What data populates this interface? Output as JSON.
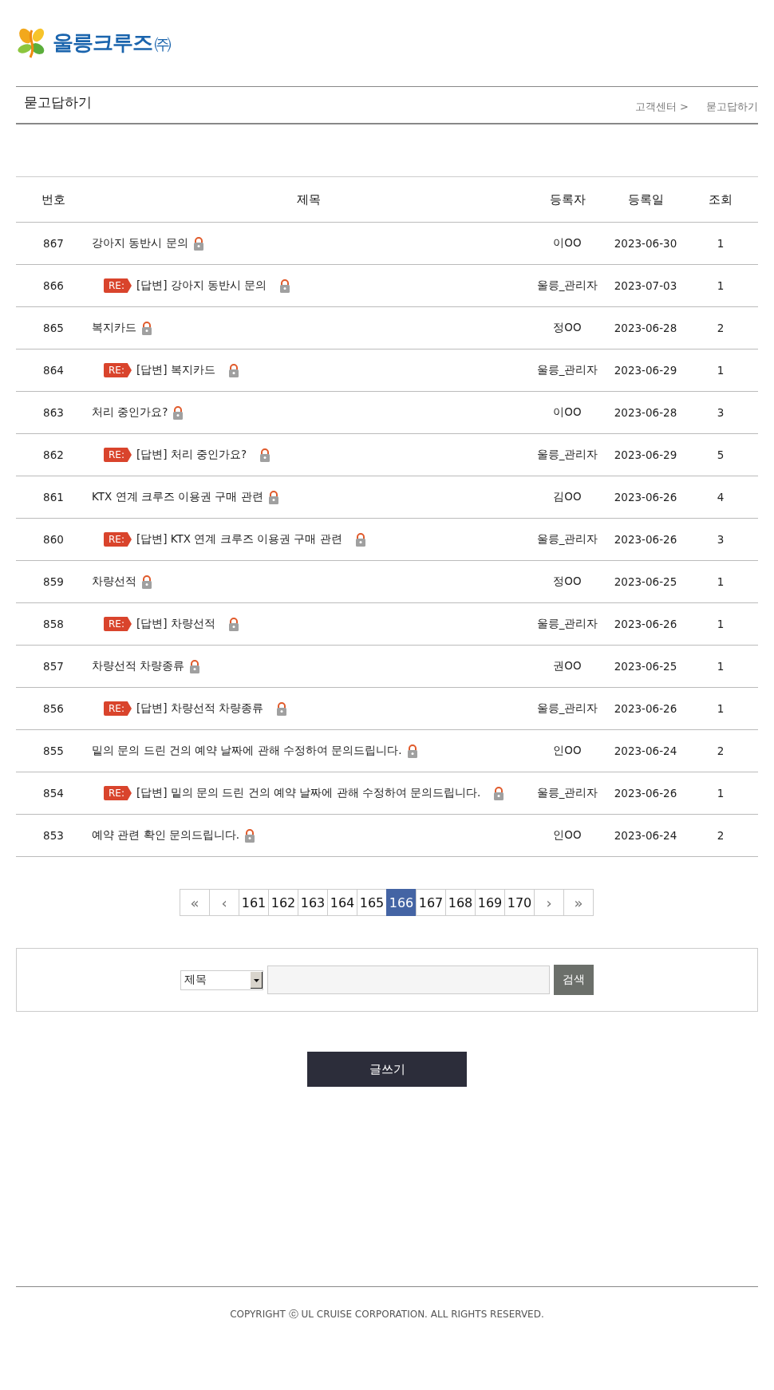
{
  "logo": {
    "name": "울릉크루즈",
    "suffix": "㈜"
  },
  "page_title": "묻고답하기",
  "breadcrumb": [
    "고객센터 >",
    "묻고답하기"
  ],
  "table": {
    "columns": [
      "번호",
      "제목",
      "등록자",
      "등록일",
      "조회"
    ],
    "rows": [
      {
        "number": "867",
        "kind": "question",
        "title": "강아지 동반시 문의",
        "locked": true,
        "author": "이OO",
        "date": "2023-06-30",
        "views": "1"
      },
      {
        "number": "866",
        "kind": "answer",
        "badge": "RE:",
        "title": "[답변] 강아지 동반시 문의",
        "locked": true,
        "author": "울릉_관리자",
        "date": "2023-07-03",
        "views": "1"
      },
      {
        "number": "865",
        "kind": "question",
        "title": "복지카드",
        "locked": true,
        "author": "정OO",
        "date": "2023-06-28",
        "views": "2"
      },
      {
        "number": "864",
        "kind": "answer",
        "badge": "RE:",
        "title": "[답변] 복지카드",
        "locked": true,
        "author": "울릉_관리자",
        "date": "2023-06-29",
        "views": "1"
      },
      {
        "number": "863",
        "kind": "question",
        "title": "처리 중인가요?",
        "locked": true,
        "author": "이OO",
        "date": "2023-06-28",
        "views": "3"
      },
      {
        "number": "862",
        "kind": "answer",
        "badge": "RE:",
        "title": "[답변] 처리 중인가요?",
        "locked": true,
        "author": "울릉_관리자",
        "date": "2023-06-29",
        "views": "5"
      },
      {
        "number": "861",
        "kind": "question",
        "title": "KTX 연계 크루즈 이용권 구매 관련",
        "locked": true,
        "author": "김OO",
        "date": "2023-06-26",
        "views": "4"
      },
      {
        "number": "860",
        "kind": "answer",
        "badge": "RE:",
        "title": "[답변] KTX 연계 크루즈 이용권 구매 관련",
        "locked": true,
        "author": "울릉_관리자",
        "date": "2023-06-26",
        "views": "3"
      },
      {
        "number": "859",
        "kind": "question",
        "title": "차량선적",
        "locked": true,
        "author": "정OO",
        "date": "2023-06-25",
        "views": "1"
      },
      {
        "number": "858",
        "kind": "answer",
        "badge": "RE:",
        "title": "[답변] 차량선적",
        "locked": true,
        "author": "울릉_관리자",
        "date": "2023-06-26",
        "views": "1"
      },
      {
        "number": "857",
        "kind": "question",
        "title": "차량선적 차량종류",
        "locked": true,
        "author": "권OO",
        "date": "2023-06-25",
        "views": "1"
      },
      {
        "number": "856",
        "kind": "answer",
        "badge": "RE:",
        "title": "[답변] 차량선적 차량종류",
        "locked": true,
        "author": "울릉_관리자",
        "date": "2023-06-26",
        "views": "1"
      },
      {
        "number": "855",
        "kind": "question",
        "title": "밑의 문의 드린 건의 예약 날짜에 관해 수정하여 문의드립니다.",
        "locked": true,
        "author": "인OO",
        "date": "2023-06-24",
        "views": "2"
      },
      {
        "number": "854",
        "kind": "answer",
        "badge": "RE:",
        "title": "[답변] 밑의 문의 드린 건의 예약 날짜에 관해 수정하여 문의드립니다.",
        "locked": true,
        "author": "울릉_관리자",
        "date": "2023-06-26",
        "views": "1"
      },
      {
        "number": "853",
        "kind": "question",
        "title": "예약 관련 확인 문의드립니다.",
        "locked": true,
        "author": "인OO",
        "date": "2023-06-24",
        "views": "2"
      }
    ]
  },
  "pagination": {
    "first": "«",
    "prev": "‹",
    "pages": [
      {
        "label": "161",
        "selected": false
      },
      {
        "label": "162",
        "selected": false
      },
      {
        "label": "163",
        "selected": false
      },
      {
        "label": "164",
        "selected": false
      },
      {
        "label": "165",
        "selected": false
      },
      {
        "label": "166",
        "selected": true
      },
      {
        "label": "167",
        "selected": false
      },
      {
        "label": "168",
        "selected": false
      },
      {
        "label": "169",
        "selected": false
      },
      {
        "label": "170",
        "selected": false
      }
    ],
    "next": "›",
    "last": "»"
  },
  "search": {
    "field_select": "제목",
    "button": "검색"
  },
  "write_button": "글쓰기",
  "footer": "COPYRIGHT ⓒ UL CRUISE CORPORATION. ALL RIGHTS RESERVED."
}
